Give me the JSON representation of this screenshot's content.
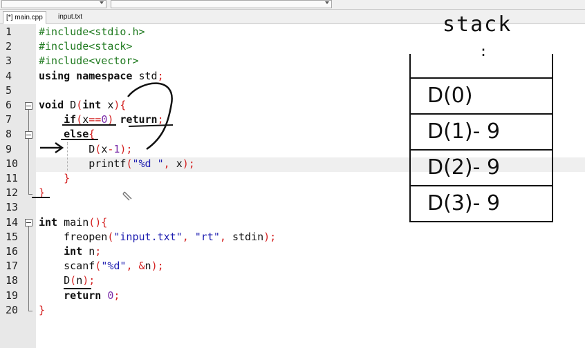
{
  "tabs": [
    {
      "label": "[*] main.cpp",
      "active": true
    },
    {
      "label": "input.txt",
      "active": false
    }
  ],
  "code_lines": [
    {
      "n": "1",
      "tokens": [
        [
          "pp",
          "#include<stdio.h>"
        ]
      ]
    },
    {
      "n": "2",
      "tokens": [
        [
          "pp",
          "#include<stack>"
        ]
      ]
    },
    {
      "n": "3",
      "tokens": [
        [
          "pp",
          "#include<vector>"
        ]
      ]
    },
    {
      "n": "4",
      "tokens": [
        [
          "kw",
          "using namespace "
        ],
        [
          "ident",
          "std"
        ],
        [
          "sym",
          ";"
        ]
      ]
    },
    {
      "n": "5",
      "tokens": []
    },
    {
      "n": "6",
      "tokens": [
        [
          "kw",
          "void "
        ],
        [
          "ident",
          "D"
        ],
        [
          "sym",
          "("
        ],
        [
          "kw",
          "int "
        ],
        [
          "ident",
          "x"
        ],
        [
          "sym",
          "){"
        ]
      ]
    },
    {
      "n": "7",
      "tokens": [
        [
          "ident",
          "    "
        ],
        [
          "kw",
          "if"
        ],
        [
          "sym",
          "("
        ],
        [
          "ident",
          "x"
        ],
        [
          "sym",
          "=="
        ],
        [
          "numlit",
          "0"
        ],
        [
          "sym",
          ") "
        ],
        [
          "kw",
          "return"
        ],
        [
          "sym",
          ";"
        ]
      ]
    },
    {
      "n": "8",
      "tokens": [
        [
          "ident",
          "    "
        ],
        [
          "kw",
          "else"
        ],
        [
          "sym",
          "{"
        ]
      ]
    },
    {
      "n": "9",
      "tokens": [
        [
          "ident",
          "        D"
        ],
        [
          "sym",
          "("
        ],
        [
          "ident",
          "x"
        ],
        [
          "sym",
          "-"
        ],
        [
          "numlit",
          "1"
        ],
        [
          "sym",
          ");"
        ]
      ]
    },
    {
      "n": "10",
      "tokens": [
        [
          "ident",
          "        printf"
        ],
        [
          "sym",
          "("
        ],
        [
          "str",
          "\"%d \""
        ],
        [
          "sym",
          ", "
        ],
        [
          "ident",
          "x"
        ],
        [
          "sym",
          ");"
        ]
      ]
    },
    {
      "n": "11",
      "tokens": [
        [
          "ident",
          "    "
        ],
        [
          "sym",
          "}"
        ]
      ]
    },
    {
      "n": "12",
      "tokens": [
        [
          "sym",
          "}"
        ]
      ]
    },
    {
      "n": "13",
      "tokens": []
    },
    {
      "n": "14",
      "tokens": [
        [
          "kw",
          "int "
        ],
        [
          "ident",
          "main"
        ],
        [
          "sym",
          "(){"
        ]
      ]
    },
    {
      "n": "15",
      "tokens": [
        [
          "ident",
          "    freopen"
        ],
        [
          "sym",
          "("
        ],
        [
          "str",
          "\"input.txt\""
        ],
        [
          "sym",
          ", "
        ],
        [
          "str",
          "\"rt\""
        ],
        [
          "sym",
          ", "
        ],
        [
          "ident",
          "stdin"
        ],
        [
          "sym",
          ");"
        ]
      ]
    },
    {
      "n": "16",
      "tokens": [
        [
          "ident",
          "    "
        ],
        [
          "kw",
          "int "
        ],
        [
          "ident",
          "n"
        ],
        [
          "sym",
          ";"
        ]
      ]
    },
    {
      "n": "17",
      "tokens": [
        [
          "ident",
          "    scanf"
        ],
        [
          "sym",
          "("
        ],
        [
          "str",
          "\"%d\""
        ],
        [
          "sym",
          ", &"
        ],
        [
          "ident",
          "n"
        ],
        [
          "sym",
          ");"
        ]
      ]
    },
    {
      "n": "18",
      "tokens": [
        [
          "ident",
          "    D"
        ],
        [
          "sym",
          "("
        ],
        [
          "ident",
          "n"
        ],
        [
          "sym",
          ");"
        ]
      ]
    },
    {
      "n": "19",
      "tokens": [
        [
          "ident",
          "    "
        ],
        [
          "kw",
          "return "
        ],
        [
          "numlit",
          "0"
        ],
        [
          "sym",
          ";"
        ]
      ]
    },
    {
      "n": "20",
      "tokens": [
        [
          "sym",
          "}"
        ]
      ]
    }
  ],
  "stack_panel": {
    "title": "stack",
    "dots": ":",
    "cells": [
      "D(0)",
      "D(1)- 9",
      "D(2)- 9",
      "D(3)- 9"
    ]
  }
}
